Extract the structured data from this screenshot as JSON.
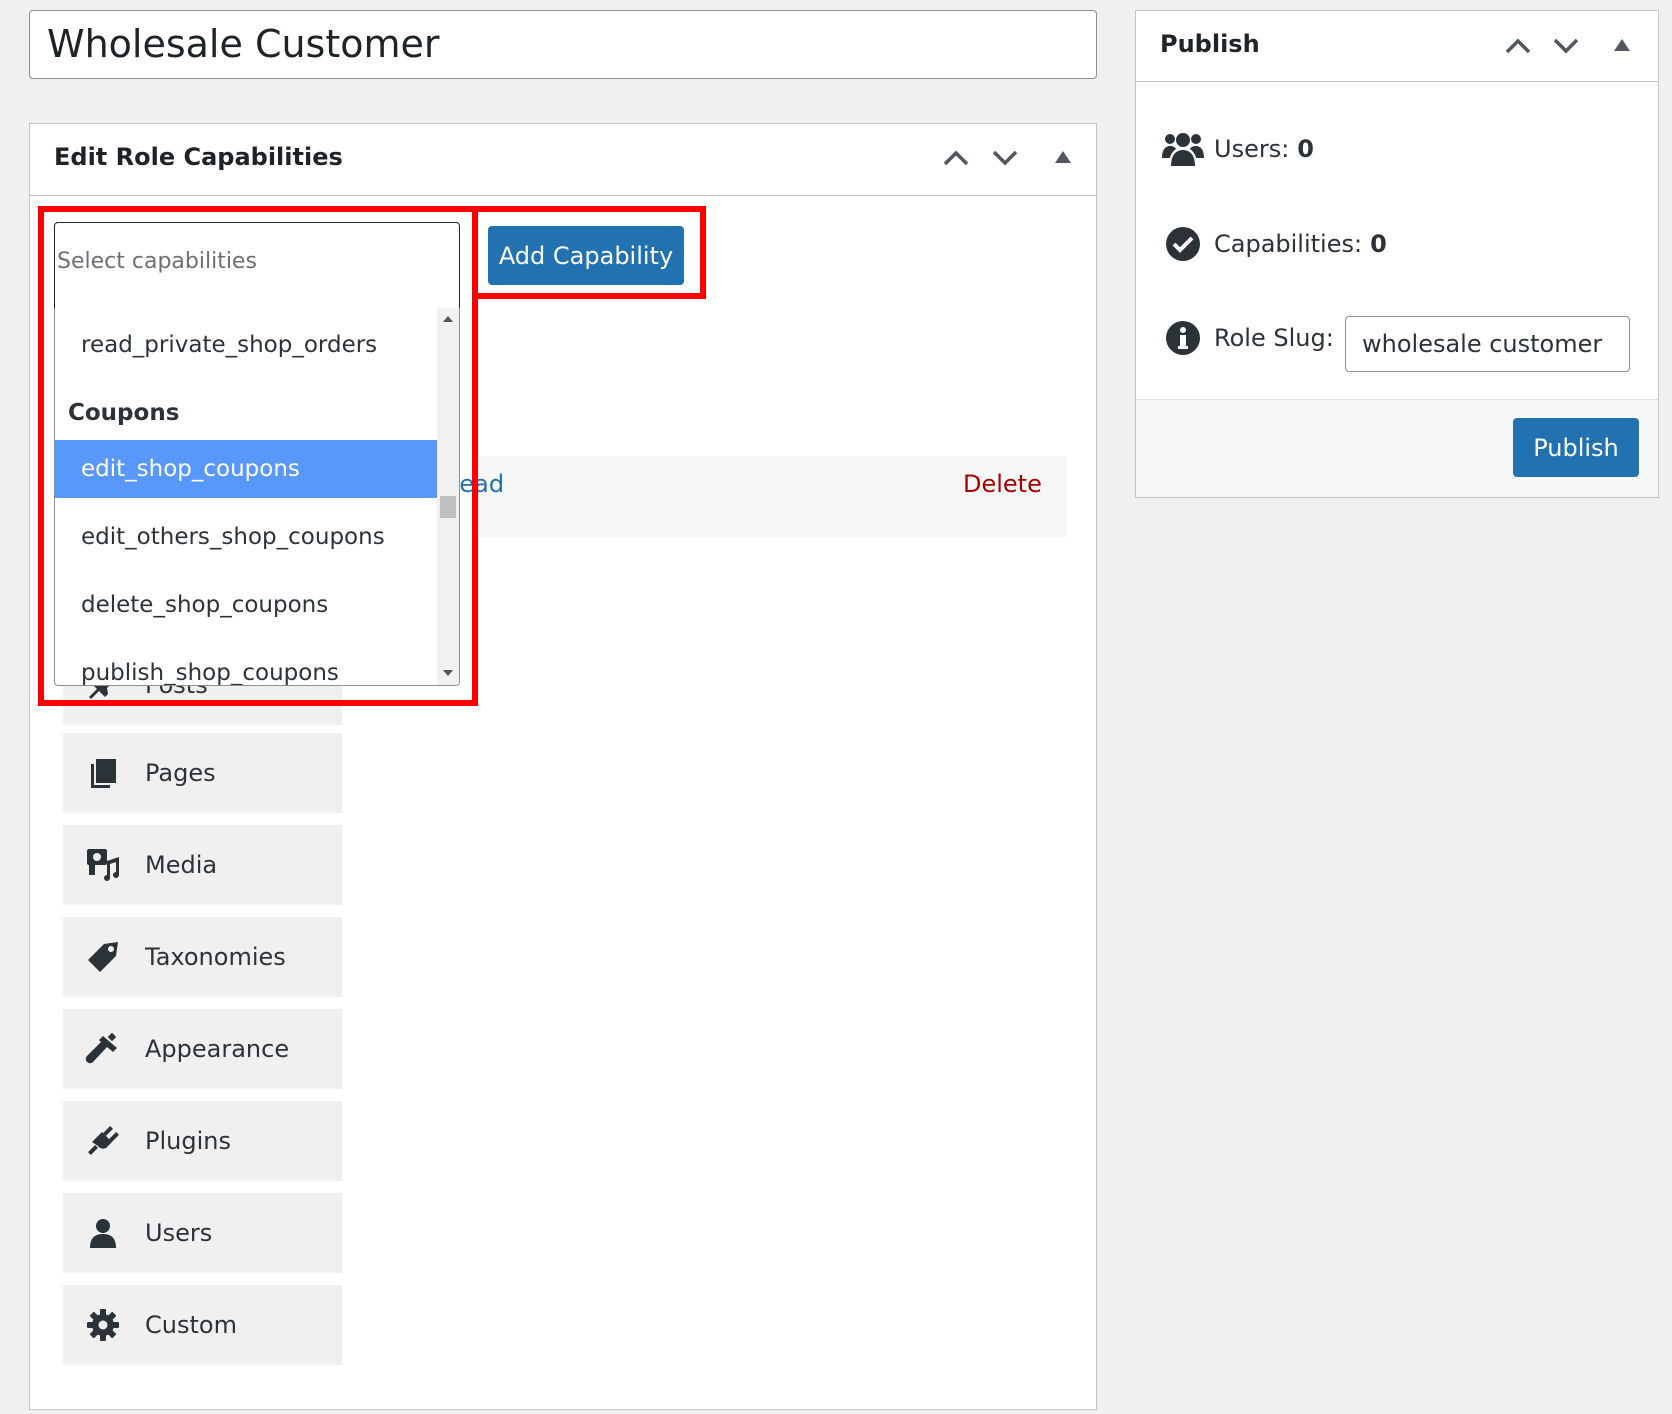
{
  "title_input": {
    "value": "Wholesale Customer"
  },
  "caps_box": {
    "title": "Edit Role Capabilities",
    "add_button": "Add Capability",
    "select_placeholder": "Select capabilities",
    "dropdown": {
      "items_before": [
        "read_private_shop_orders"
      ],
      "group_label": "Coupons",
      "items": [
        "edit_shop_coupons",
        "edit_others_shop_coupons",
        "delete_shop_coupons",
        "publish_shop_coupons"
      ],
      "highlighted": "edit_shop_coupons"
    },
    "capability_row": {
      "name": "read",
      "delete_label": "Delete"
    },
    "menu": [
      {
        "label": "Posts",
        "icon": "pin-icon"
      },
      {
        "label": "Pages",
        "icon": "pages-icon"
      },
      {
        "label": "Media",
        "icon": "media-icon"
      },
      {
        "label": "Taxonomies",
        "icon": "tag-icon"
      },
      {
        "label": "Appearance",
        "icon": "paintbrush-icon"
      },
      {
        "label": "Plugins",
        "icon": "plugin-icon"
      },
      {
        "label": "Users",
        "icon": "user-icon"
      },
      {
        "label": "Custom",
        "icon": "gear-icon"
      }
    ]
  },
  "publish_box": {
    "title": "Publish",
    "users_label": "Users:",
    "users_count": "0",
    "caps_label": "Capabilities:",
    "caps_count": "0",
    "slug_label": "Role Slug:",
    "slug_value": "wholesale customer",
    "publish_button": "Publish"
  },
  "colors": {
    "primary": "#2271b1",
    "highlight": "#5897fb",
    "annotation": "#ff0000",
    "delete": "#aa0000"
  }
}
